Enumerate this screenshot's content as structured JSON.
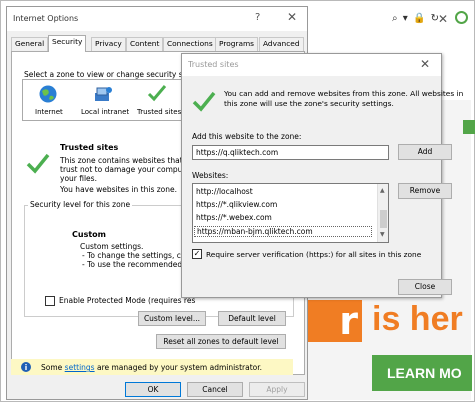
{
  "browser": {
    "close_glyph": "✕",
    "icons": "⌕ ▾ 🔒 ↻"
  },
  "background_page": {
    "big_letter": "r",
    "headline": "is her",
    "cta": "LEARN MO"
  },
  "internet_options": {
    "title": "Internet Options",
    "help_glyph": "?",
    "close_glyph": "✕",
    "tabs": [
      "General",
      "Security",
      "Privacy",
      "Content",
      "Connections",
      "Programs",
      "Advanced"
    ],
    "active_tab": "Security",
    "zone_prompt": "Select a zone to view or change security settings.",
    "zones": [
      "Internet",
      "Local intranet",
      "Trusted sites"
    ],
    "zone_title": "Trusted sites",
    "zone_desc": [
      "This zone contains websites that you",
      "trust not to damage your computer or",
      "your files.",
      "You have websites in this zone."
    ],
    "security_level_label": "Security level for this zone",
    "custom_title": "Custom",
    "custom_lines": [
      "Custom settings.",
      "- To change the settings, click",
      "- To use the recommended se"
    ],
    "protected_mode_label": "Enable Protected Mode (requires res",
    "custom_level_button": "Custom level...",
    "default_level_button": "Default level",
    "reset_all_button": "Reset all zones to default level",
    "info_prefix": "Some",
    "info_link": "settings",
    "info_suffix": "are managed by your system administrator.",
    "ok_button": "OK",
    "cancel_button": "Cancel",
    "apply_button": "Apply"
  },
  "trusted_sites": {
    "title": "Trusted sites",
    "close_glyph": "✕",
    "description": [
      "You can add and remove websites from this zone. All websites in",
      "this zone will use the zone's security settings."
    ],
    "add_label": "Add this website to the zone:",
    "add_value": "https://q.qliktech.com",
    "add_button": "Add",
    "websites_label": "Websites:",
    "websites": [
      "http://localhost",
      "https://*.qlikview.com",
      "https://*.webex.com",
      "https://mban-bjm.qliktech.com"
    ],
    "remove_button": "Remove",
    "require_https_label": "Require server verification (https:) for all sites in this zone",
    "close_button": "Close"
  },
  "colors": {
    "check_green": "#4caf50",
    "accent_blue": "#0078d7",
    "brand_orange": "#f07d23",
    "brand_green": "#52a548"
  }
}
